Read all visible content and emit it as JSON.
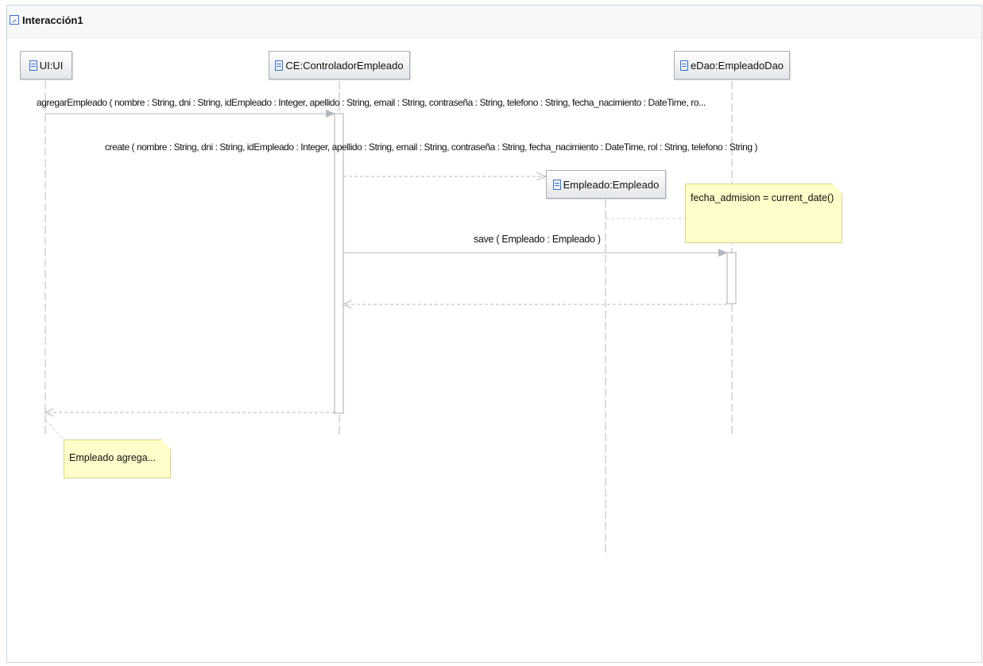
{
  "frame": {
    "title": "Interacción1"
  },
  "lifelines": {
    "ui": {
      "label": "UI:UI"
    },
    "ce": {
      "label": "CE:ControladorEmpleado"
    },
    "edao": {
      "label": "eDao:EmpleadoDao"
    },
    "empleado": {
      "label": "Empleado:Empleado"
    }
  },
  "messages": {
    "agregar": {
      "label": "agregarEmpleado ( nombre : String, dni : String, idEmpleado : Integer, apellido : String, email : String, contraseña : String, telefono : String, fecha_nacimiento : DateTime, ro..."
    },
    "create": {
      "label": "create ( nombre : String, dni : String, idEmpleado : Integer, apellido : String, email : String, contraseña : String, fecha_nacimiento : DateTime, rol : String, telefono : String )"
    },
    "save": {
      "label": "save ( Empleado : Empleado )"
    }
  },
  "notes": {
    "fecha": {
      "text": "fecha_admision = current_date()"
    },
    "agrega": {
      "text": "Empleado agrega..."
    }
  },
  "colors": {
    "line": "#a8adb3",
    "icon": "#3a73c4",
    "note_bg": "#fffdc9",
    "note_border": "#d9d28a"
  }
}
